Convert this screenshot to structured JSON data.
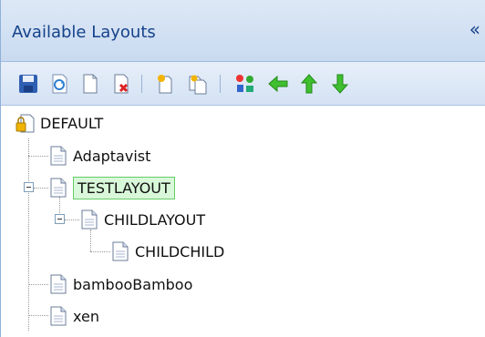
{
  "panel": {
    "title": "Available Layouts",
    "collapse_glyph": "«"
  },
  "toolbar": {
    "buttons": [
      {
        "name": "save-icon"
      },
      {
        "name": "refresh-icon"
      },
      {
        "name": "new-page-icon"
      },
      {
        "name": "delete-page-icon"
      },
      {
        "name": "new-child-icon"
      },
      {
        "name": "copy-page-icon"
      },
      {
        "name": "rearrange-icon"
      },
      {
        "name": "arrow-left-icon"
      },
      {
        "name": "arrow-up-icon"
      },
      {
        "name": "arrow-down-icon"
      }
    ]
  },
  "tree": {
    "nodes": [
      {
        "label": "DEFAULT",
        "icon": "locked-page-icon"
      },
      {
        "label": "Adaptavist",
        "icon": "page-icon"
      },
      {
        "label": "TESTLAYOUT",
        "icon": "page-icon",
        "selected": true,
        "expanded": true
      },
      {
        "label": "CHILDLAYOUT",
        "icon": "page-icon",
        "expanded": true
      },
      {
        "label": "CHILDCHILD",
        "icon": "page-icon"
      },
      {
        "label": "bambooBamboo",
        "icon": "page-icon"
      },
      {
        "label": "xen",
        "icon": "page-icon"
      }
    ]
  },
  "colors": {
    "header_text": "#15428b",
    "selected_bg": "#d9f7d9",
    "selected_border": "#66cc66"
  }
}
